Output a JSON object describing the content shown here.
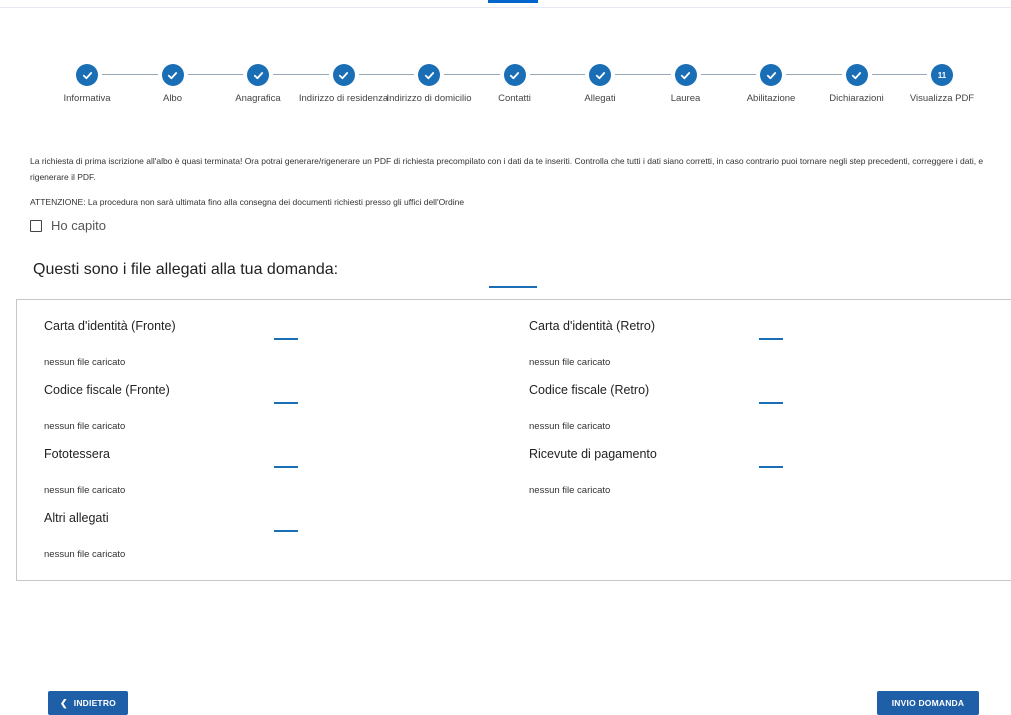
{
  "stepper": {
    "steps": [
      {
        "label": "Informativa",
        "done": true
      },
      {
        "label": "Albo",
        "done": true
      },
      {
        "label": "Anagrafica",
        "done": true
      },
      {
        "label": "Indirizzo di residenza",
        "done": true
      },
      {
        "label": "Indirizzo di domicilio",
        "done": true
      },
      {
        "label": "Contatti",
        "done": true
      },
      {
        "label": "Allegati",
        "done": true
      },
      {
        "label": "Laurea",
        "done": true
      },
      {
        "label": "Abilitazione",
        "done": true
      },
      {
        "label": "Dichiarazioni",
        "done": true
      },
      {
        "label": "Visualizza PDF",
        "done": false,
        "number": "11"
      }
    ]
  },
  "intro_text": "La richiesta di prima iscrizione all'albo è quasi terminata! Ora potrai generare/rigenerare un PDF di richiesta precompilato con i dati da te inseriti. Controlla che tutti i dati siano corretti, in caso contrario puoi tornare negli step precedenti, correggere i dati, e rigenerare il PDF.",
  "warning_text": "ATTENZIONE: La procedura non sarà ultimata fino alla consegna dei documenti richiesti presso gli uffici dell'Ordine",
  "acknowledge": {
    "label": "Ho capito",
    "checked": false
  },
  "files_title": "Questi sono i file allegati alla tua domanda:",
  "files": [
    {
      "name": "Carta d'identità (Fronte)",
      "status": "nessun file caricato"
    },
    {
      "name": "Carta d'identità (Retro)",
      "status": "nessun file caricato"
    },
    {
      "name": "Codice fiscale (Fronte)",
      "status": "nessun file caricato"
    },
    {
      "name": "Codice fiscale (Retro)",
      "status": "nessun file caricato"
    },
    {
      "name": "Fototessera",
      "status": "nessun file caricato"
    },
    {
      "name": "Ricevute di pagamento",
      "status": "nessun file caricato"
    },
    {
      "name": "Altri allegati",
      "status": "nessun file caricato"
    }
  ],
  "buttons": {
    "back": "INDIETRO",
    "submit": "INVIO DOMANDA"
  },
  "colors": {
    "primary": "#1a6eb5",
    "button": "#1f5fa8"
  }
}
